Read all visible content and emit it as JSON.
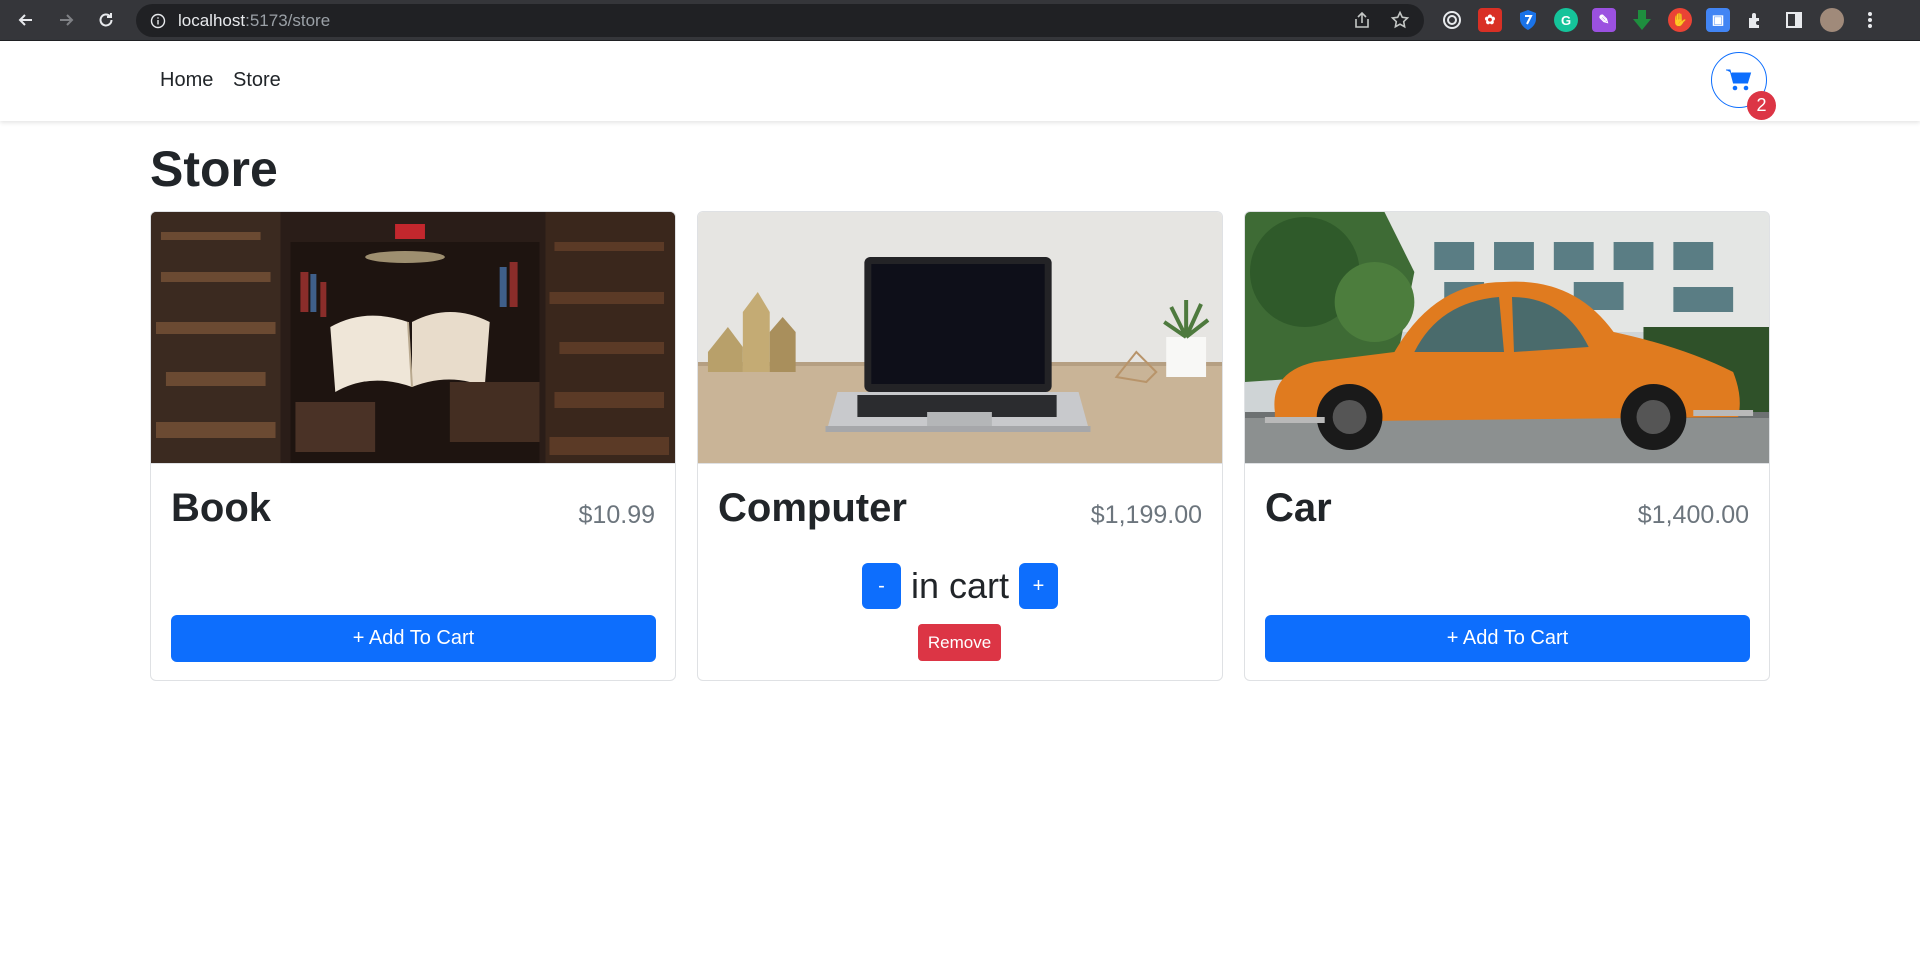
{
  "browser": {
    "url_host": "localhost",
    "url_path": ":5173/store",
    "extensions": [
      "target-icon",
      "puzzle-red-icon",
      "shield-icon",
      "grammarly-icon",
      "magic-icon",
      "download-icon",
      "stop-icon",
      "screen-icon",
      "extensions-icon",
      "sidebar-icon",
      "profile-avatar",
      "menu-icon"
    ]
  },
  "navbar": {
    "links": [
      "Home",
      "Store"
    ],
    "cart_count": "2"
  },
  "page": {
    "title": "Store"
  },
  "products": [
    {
      "name": "Book",
      "price": "$10.99",
      "action": "+ Add To Cart"
    },
    {
      "name": "Computer",
      "price": "$1,199.00",
      "decrement": "-",
      "qty_text": "in cart",
      "increment": "+",
      "remove": "Remove"
    },
    {
      "name": "Car",
      "price": "$1,400.00",
      "action": "+ Add To Cart"
    }
  ],
  "colors": {
    "primary": "#0d6efd",
    "danger": "#dc3545",
    "muted": "#6c757d"
  }
}
